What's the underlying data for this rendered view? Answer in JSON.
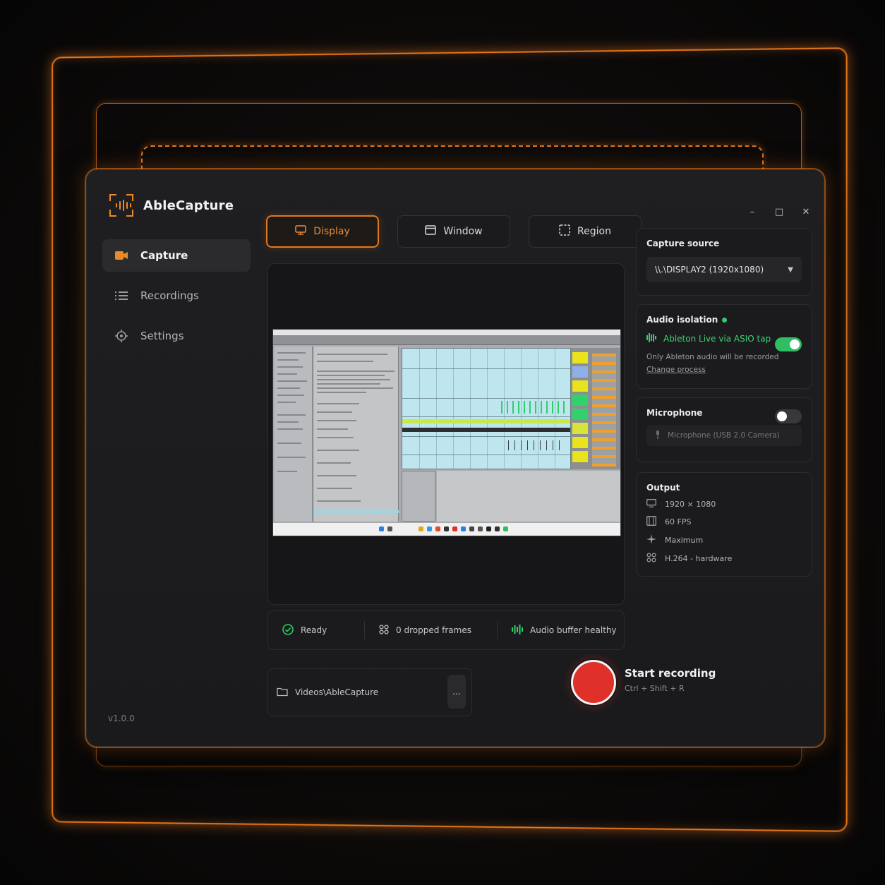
{
  "app": {
    "name": "AbleCapture",
    "version": "v1.0.0"
  },
  "colors": {
    "accent": "#e4761b",
    "record": "#e0302a",
    "success": "#2fcf6a"
  },
  "sidebar": {
    "items": [
      {
        "label": "Capture",
        "icon": "camera-icon",
        "active": true
      },
      {
        "label": "Recordings",
        "icon": "list-icon",
        "active": false
      },
      {
        "label": "Settings",
        "icon": "settings-icon",
        "active": false
      }
    ]
  },
  "window_controls": {
    "minimize": "–",
    "maximize": "□",
    "close": "✕"
  },
  "tabs": [
    {
      "label": "Display",
      "icon": "monitor-icon",
      "active": true
    },
    {
      "label": "Window",
      "icon": "window-icon",
      "active": false
    },
    {
      "label": "Region",
      "icon": "region-icon",
      "active": false
    }
  ],
  "status": {
    "ready": "Ready",
    "dropped": "0 dropped frames",
    "buffer": "Audio buffer healthy"
  },
  "output_path": {
    "value": "Videos\\AbleCapture",
    "more": "..."
  },
  "record": {
    "label": "Start recording",
    "shortcut": "Ctrl + Shift + R"
  },
  "capture_source": {
    "title": "Capture source",
    "selected": "\\\\.\\DISPLAY2 (1920x1080)"
  },
  "audio_isolation": {
    "title": "Audio isolation",
    "enabled": true,
    "source": "Ableton Live via ASIO tap",
    "note": "Only Ableton audio will be recorded",
    "link": "Change process"
  },
  "microphone": {
    "title": "Microphone",
    "enabled": false,
    "placeholder": "Microphone (USB 2.0 Camera)"
  },
  "output": {
    "title": "Output",
    "resolution": "1920 × 1080",
    "fps": "60 FPS",
    "quality": "Maximum",
    "codec": "H.264 - hardware"
  }
}
